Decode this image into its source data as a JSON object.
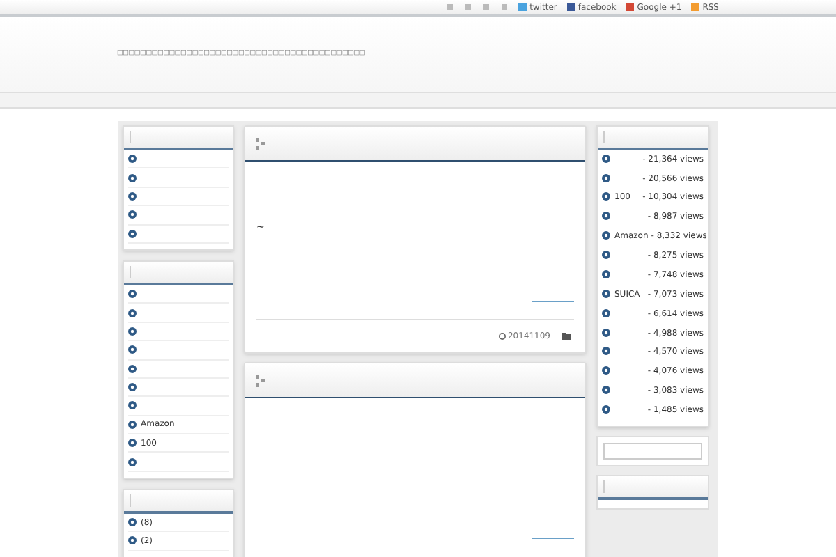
{
  "top_links": [
    {
      "kind": "icon"
    },
    {
      "kind": "icon"
    },
    {
      "kind": "icon"
    },
    {
      "kind": "icon"
    },
    {
      "kind": "twitter",
      "label": "twitter"
    },
    {
      "kind": "facebook",
      "label": "facebook"
    },
    {
      "kind": "google",
      "label": "Google +1"
    },
    {
      "kind": "rss",
      "label": "RSS"
    }
  ],
  "tagline": "□□□□□□□□□□□□□□□□□□□□□□□□□□□□□□□□□□□□□□□□□□□",
  "left_widgets": [
    {
      "items": [
        {
          "kind": "blank"
        },
        {
          "kind": "blank"
        },
        {
          "kind": "blank"
        },
        {
          "kind": "blank"
        },
        {
          "kind": "blank"
        }
      ]
    },
    {
      "items": [
        {
          "kind": "blank"
        },
        {
          "kind": "blank"
        },
        {
          "kind": "blank"
        },
        {
          "kind": "blank"
        },
        {
          "kind": "blank"
        },
        {
          "kind": "blank"
        },
        {
          "kind": "blank"
        },
        {
          "kind": "text",
          "label": "Amazon"
        },
        {
          "kind": "text",
          "label": "100"
        },
        {
          "kind": "blank"
        }
      ]
    },
    {
      "items": [
        {
          "kind": "text",
          "label": "(8)"
        },
        {
          "kind": "text",
          "label": "(2)"
        }
      ]
    }
  ],
  "posts": [
    {
      "kind": "full",
      "excerpt": "~",
      "date": "20141109"
    },
    {
      "kind": "partial"
    }
  ],
  "popular": [
    {
      "views": "- 21,364 views"
    },
    {
      "views": "- 20,566 views"
    },
    {
      "label": "100",
      "views": "- 10,304 views"
    },
    {
      "views": "- 8,987 views"
    },
    {
      "label": "Amazon",
      "views": "- 8,332 views"
    },
    {
      "views": "- 8,275 views"
    },
    {
      "views": "- 7,748 views"
    },
    {
      "label": "SUICA",
      "views": "- 7,073 views"
    },
    {
      "views": "- 6,614 views"
    },
    {
      "views": "- 4,988 views"
    },
    {
      "views": "- 4,570 views"
    },
    {
      "views": "- 4,076 views"
    },
    {
      "views": "- 3,083 views"
    },
    {
      "views": "- 1,485 views"
    }
  ]
}
